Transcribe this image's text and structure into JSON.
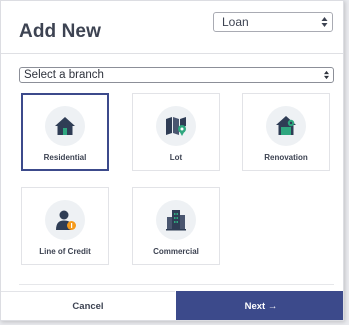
{
  "dialog": {
    "title": "Add New",
    "loan_type": {
      "selected": "Loan"
    },
    "branch": {
      "selected": "Select a branch"
    },
    "options": [
      {
        "label": "Residential",
        "icon": "house-icon",
        "selected": true
      },
      {
        "label": "Lot",
        "icon": "map-pin-icon",
        "selected": false
      },
      {
        "label": "Renovation",
        "icon": "house-gear-icon",
        "selected": false
      },
      {
        "label": "Line of Credit",
        "icon": "person-coin-icon",
        "selected": false
      },
      {
        "label": "Commercial",
        "icon": "office-building-icon",
        "selected": false
      }
    ],
    "footer": {
      "cancel_label": "Cancel",
      "next_label": "Next →"
    }
  },
  "colors": {
    "accent": "#3c4a8b",
    "icon_dark": "#2f3d55",
    "icon_green": "#2fa77f",
    "icon_orange": "#f59a1b",
    "icon_bg": "#eef1f4"
  }
}
